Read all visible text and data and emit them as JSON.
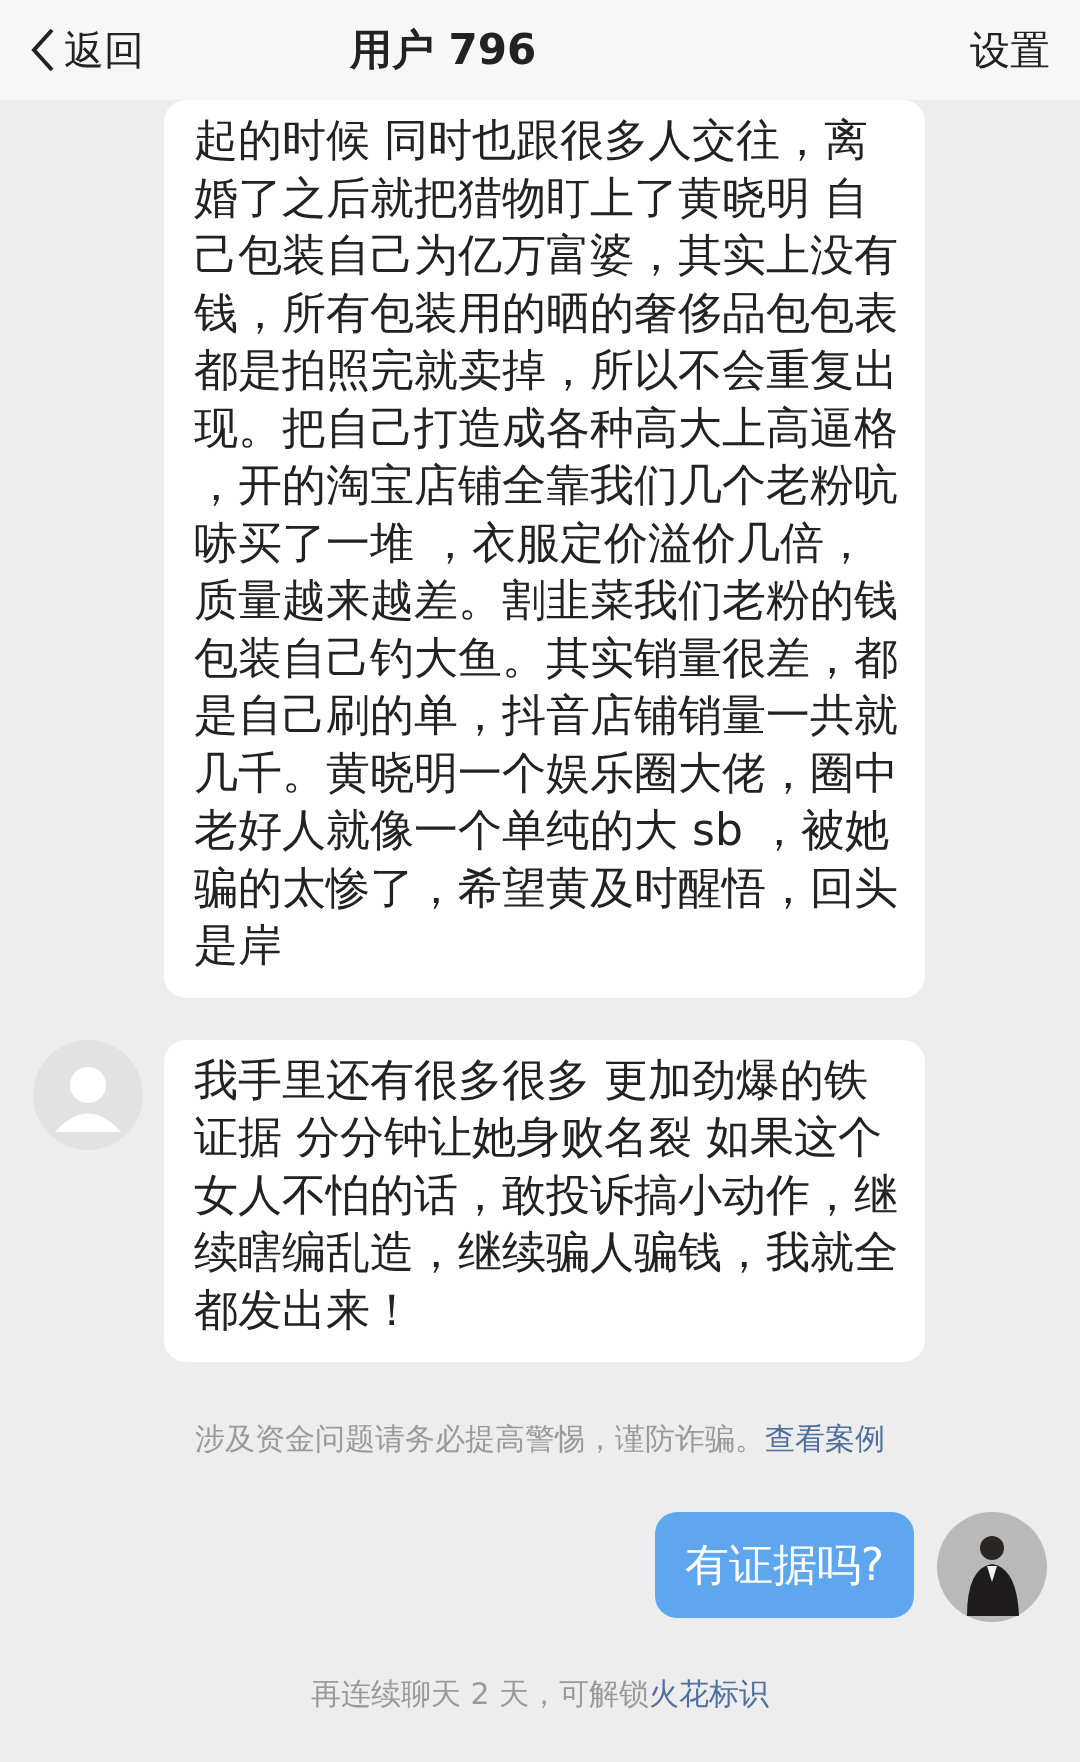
{
  "header": {
    "back": "返回",
    "title": "用户 796",
    "settings": "设置"
  },
  "messages": [
    {
      "kind": "incoming",
      "avatar": false,
      "text": "起的时候 同时也跟很多人交往，离婚了之后就把猎物盯上了黄晓明 自己包装自己为亿万富婆，其实上没有钱，所有包装用的晒的奢侈品包包表都是拍照完就卖掉，所以不会重复出现。把自己打造成各种高大上高逼格，开的淘宝店铺全靠我们几个老粉吭哧买了一堆 ，衣服定价溢价几倍，质量越来越差。割韭菜我们老粉的钱包装自己钓大鱼。其实销量很差，都是自己刷的单，抖音店铺销量一共就几千。黄晓明一个娱乐圈大佬，圈中老好人就像一个单纯的大 sb ，被她骗的太惨了，希望黄及时醒悟，回头是岸"
    },
    {
      "kind": "incoming",
      "avatar": true,
      "text": "我手里还有很多很多 更加劲爆的铁证据 分分钟让她身败名裂  如果这个女人不怕的话，敢投诉搞小动作，继续瞎编乱造，继续骗人骗钱，我就全都发出来！"
    },
    {
      "kind": "notice",
      "text": "涉及资金问题请务必提高警惕，谨防诈骗。",
      "link": "查看案例"
    },
    {
      "kind": "outgoing",
      "avatar": true,
      "text": "有证据吗?"
    },
    {
      "kind": "notice",
      "text": "再连续聊天 2 天，可解锁",
      "link": "火花标识"
    }
  ]
}
